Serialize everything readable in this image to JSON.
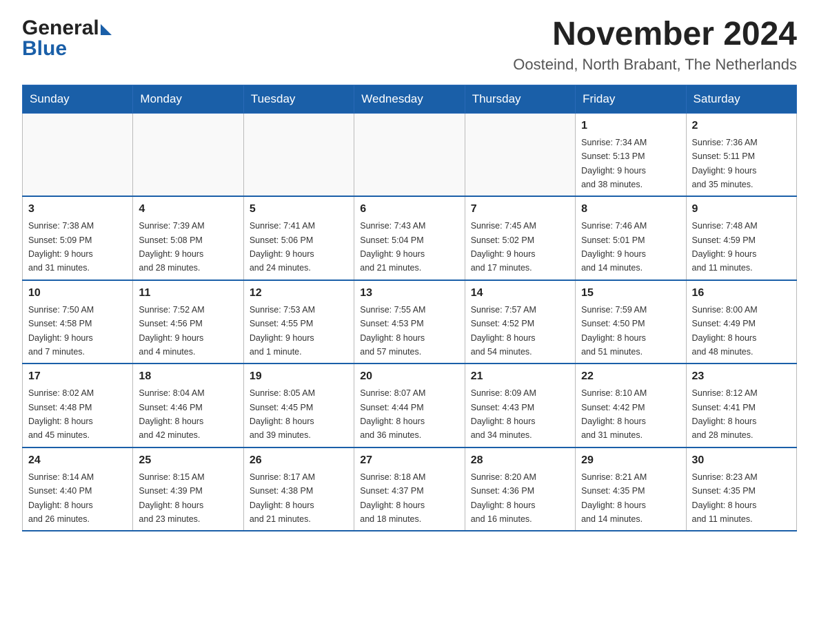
{
  "logo": {
    "general": "General",
    "blue": "Blue"
  },
  "header": {
    "month_year": "November 2024",
    "location": "Oosteind, North Brabant, The Netherlands"
  },
  "days_of_week": [
    "Sunday",
    "Monday",
    "Tuesday",
    "Wednesday",
    "Thursday",
    "Friday",
    "Saturday"
  ],
  "weeks": [
    [
      {
        "day": "",
        "info": ""
      },
      {
        "day": "",
        "info": ""
      },
      {
        "day": "",
        "info": ""
      },
      {
        "day": "",
        "info": ""
      },
      {
        "day": "",
        "info": ""
      },
      {
        "day": "1",
        "info": "Sunrise: 7:34 AM\nSunset: 5:13 PM\nDaylight: 9 hours\nand 38 minutes."
      },
      {
        "day": "2",
        "info": "Sunrise: 7:36 AM\nSunset: 5:11 PM\nDaylight: 9 hours\nand 35 minutes."
      }
    ],
    [
      {
        "day": "3",
        "info": "Sunrise: 7:38 AM\nSunset: 5:09 PM\nDaylight: 9 hours\nand 31 minutes."
      },
      {
        "day": "4",
        "info": "Sunrise: 7:39 AM\nSunset: 5:08 PM\nDaylight: 9 hours\nand 28 minutes."
      },
      {
        "day": "5",
        "info": "Sunrise: 7:41 AM\nSunset: 5:06 PM\nDaylight: 9 hours\nand 24 minutes."
      },
      {
        "day": "6",
        "info": "Sunrise: 7:43 AM\nSunset: 5:04 PM\nDaylight: 9 hours\nand 21 minutes."
      },
      {
        "day": "7",
        "info": "Sunrise: 7:45 AM\nSunset: 5:02 PM\nDaylight: 9 hours\nand 17 minutes."
      },
      {
        "day": "8",
        "info": "Sunrise: 7:46 AM\nSunset: 5:01 PM\nDaylight: 9 hours\nand 14 minutes."
      },
      {
        "day": "9",
        "info": "Sunrise: 7:48 AM\nSunset: 4:59 PM\nDaylight: 9 hours\nand 11 minutes."
      }
    ],
    [
      {
        "day": "10",
        "info": "Sunrise: 7:50 AM\nSunset: 4:58 PM\nDaylight: 9 hours\nand 7 minutes."
      },
      {
        "day": "11",
        "info": "Sunrise: 7:52 AM\nSunset: 4:56 PM\nDaylight: 9 hours\nand 4 minutes."
      },
      {
        "day": "12",
        "info": "Sunrise: 7:53 AM\nSunset: 4:55 PM\nDaylight: 9 hours\nand 1 minute."
      },
      {
        "day": "13",
        "info": "Sunrise: 7:55 AM\nSunset: 4:53 PM\nDaylight: 8 hours\nand 57 minutes."
      },
      {
        "day": "14",
        "info": "Sunrise: 7:57 AM\nSunset: 4:52 PM\nDaylight: 8 hours\nand 54 minutes."
      },
      {
        "day": "15",
        "info": "Sunrise: 7:59 AM\nSunset: 4:50 PM\nDaylight: 8 hours\nand 51 minutes."
      },
      {
        "day": "16",
        "info": "Sunrise: 8:00 AM\nSunset: 4:49 PM\nDaylight: 8 hours\nand 48 minutes."
      }
    ],
    [
      {
        "day": "17",
        "info": "Sunrise: 8:02 AM\nSunset: 4:48 PM\nDaylight: 8 hours\nand 45 minutes."
      },
      {
        "day": "18",
        "info": "Sunrise: 8:04 AM\nSunset: 4:46 PM\nDaylight: 8 hours\nand 42 minutes."
      },
      {
        "day": "19",
        "info": "Sunrise: 8:05 AM\nSunset: 4:45 PM\nDaylight: 8 hours\nand 39 minutes."
      },
      {
        "day": "20",
        "info": "Sunrise: 8:07 AM\nSunset: 4:44 PM\nDaylight: 8 hours\nand 36 minutes."
      },
      {
        "day": "21",
        "info": "Sunrise: 8:09 AM\nSunset: 4:43 PM\nDaylight: 8 hours\nand 34 minutes."
      },
      {
        "day": "22",
        "info": "Sunrise: 8:10 AM\nSunset: 4:42 PM\nDaylight: 8 hours\nand 31 minutes."
      },
      {
        "day": "23",
        "info": "Sunrise: 8:12 AM\nSunset: 4:41 PM\nDaylight: 8 hours\nand 28 minutes."
      }
    ],
    [
      {
        "day": "24",
        "info": "Sunrise: 8:14 AM\nSunset: 4:40 PM\nDaylight: 8 hours\nand 26 minutes."
      },
      {
        "day": "25",
        "info": "Sunrise: 8:15 AM\nSunset: 4:39 PM\nDaylight: 8 hours\nand 23 minutes."
      },
      {
        "day": "26",
        "info": "Sunrise: 8:17 AM\nSunset: 4:38 PM\nDaylight: 8 hours\nand 21 minutes."
      },
      {
        "day": "27",
        "info": "Sunrise: 8:18 AM\nSunset: 4:37 PM\nDaylight: 8 hours\nand 18 minutes."
      },
      {
        "day": "28",
        "info": "Sunrise: 8:20 AM\nSunset: 4:36 PM\nDaylight: 8 hours\nand 16 minutes."
      },
      {
        "day": "29",
        "info": "Sunrise: 8:21 AM\nSunset: 4:35 PM\nDaylight: 8 hours\nand 14 minutes."
      },
      {
        "day": "30",
        "info": "Sunrise: 8:23 AM\nSunset: 4:35 PM\nDaylight: 8 hours\nand 11 minutes."
      }
    ]
  ]
}
